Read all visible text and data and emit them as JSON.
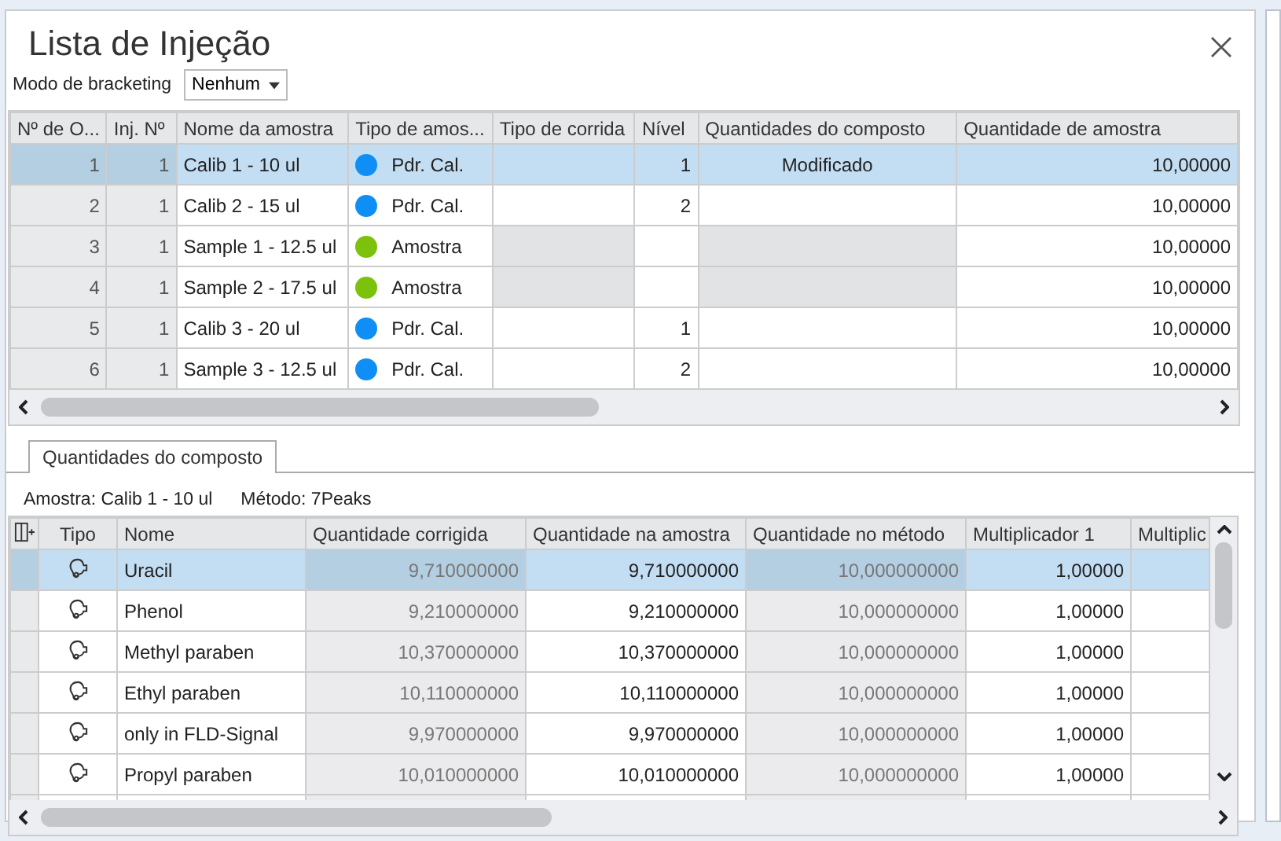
{
  "window": {
    "title": "Lista de Injeção"
  },
  "bracketing": {
    "label": "Modo de bracketing",
    "value": "Nenhum"
  },
  "injection_table": {
    "columns": [
      "Nº de O...",
      "Inj. Nº",
      "Nome da amostra",
      "Tipo de amos...",
      "Tipo de corrida",
      "Nível",
      "Quantidades do composto",
      "Quantidade de amostra"
    ],
    "rows": [
      {
        "order": "1",
        "inj": "1",
        "name": "Calib 1 - 10 ul",
        "type": "Pdr. Cal.",
        "color": "#0f8ff5",
        "level": "1",
        "compound": "Modificado",
        "amount": "10,00000",
        "selected": true,
        "disabled": false
      },
      {
        "order": "2",
        "inj": "1",
        "name": "Calib 2 - 15 ul",
        "type": "Pdr. Cal.",
        "color": "#0f8ff5",
        "level": "2",
        "amount": "10,00000",
        "selected": false,
        "disabled": false
      },
      {
        "order": "3",
        "inj": "1",
        "name": "Sample 1 - 12.5 ul",
        "type": "Amostra",
        "color": "#7cc20c",
        "amount": "10,00000",
        "selected": false,
        "disabled": true
      },
      {
        "order": "4",
        "inj": "1",
        "name": "Sample 2 - 17.5 ul",
        "type": "Amostra",
        "color": "#7cc20c",
        "amount": "10,00000",
        "selected": false,
        "disabled": true
      },
      {
        "order": "5",
        "inj": "1",
        "name": "Calib 3 - 20 ul",
        "type": "Pdr. Cal.",
        "color": "#0f8ff5",
        "level": "1",
        "amount": "10,00000",
        "selected": false,
        "disabled": false
      },
      {
        "order": "6",
        "inj": "1",
        "name": "Sample 3 - 12.5 ul",
        "type": "Pdr. Cal.",
        "color": "#0f8ff5",
        "level": "2",
        "amount": "10,00000",
        "selected": false,
        "disabled": false
      }
    ]
  },
  "tabs": [
    {
      "label": "Quantidades do composto",
      "selected": true
    }
  ],
  "info": {
    "sample": "Amostra: Calib 1 - 10 ul",
    "method": "Método: 7Peaks"
  },
  "compound_table": {
    "columns": [
      {
        "label": "Tipo",
        "readonly": false
      },
      {
        "label": "Nome",
        "readonly": false
      },
      {
        "label": "Quantidade corrigida",
        "readonly": true
      },
      {
        "label": "Quantidade na amostra",
        "readonly": false
      },
      {
        "label": "Quantidade no método",
        "readonly": true
      },
      {
        "label": "Multiplicador 1",
        "readonly": false
      },
      {
        "label": "Multiplic",
        "readonly": false
      }
    ],
    "rows": [
      {
        "name": "Uracil",
        "corrected": "9,710000000",
        "in_sample": "9,710000000",
        "in_method": "10,000000000",
        "mult1": "1,00000",
        "selected": true
      },
      {
        "name": "Phenol",
        "corrected": "9,210000000",
        "in_sample": "9,210000000",
        "in_method": "10,000000000",
        "mult1": "1,00000",
        "selected": false
      },
      {
        "name": "Methyl paraben",
        "corrected": "10,370000000",
        "in_sample": "10,370000000",
        "in_method": "10,000000000",
        "mult1": "1,00000",
        "selected": false
      },
      {
        "name": "Ethyl paraben",
        "corrected": "10,110000000",
        "in_sample": "10,110000000",
        "in_method": "10,000000000",
        "mult1": "1,00000",
        "selected": false
      },
      {
        "name": "only in FLD-Signal",
        "corrected": "9,970000000",
        "in_sample": "9,970000000",
        "in_method": "10,000000000",
        "mult1": "1,00000",
        "selected": false
      },
      {
        "name": "Propyl paraben",
        "corrected": "10,010000000",
        "in_sample": "10,010000000",
        "in_method": "10,000000000",
        "mult1": "1,00000",
        "selected": false
      }
    ]
  }
}
